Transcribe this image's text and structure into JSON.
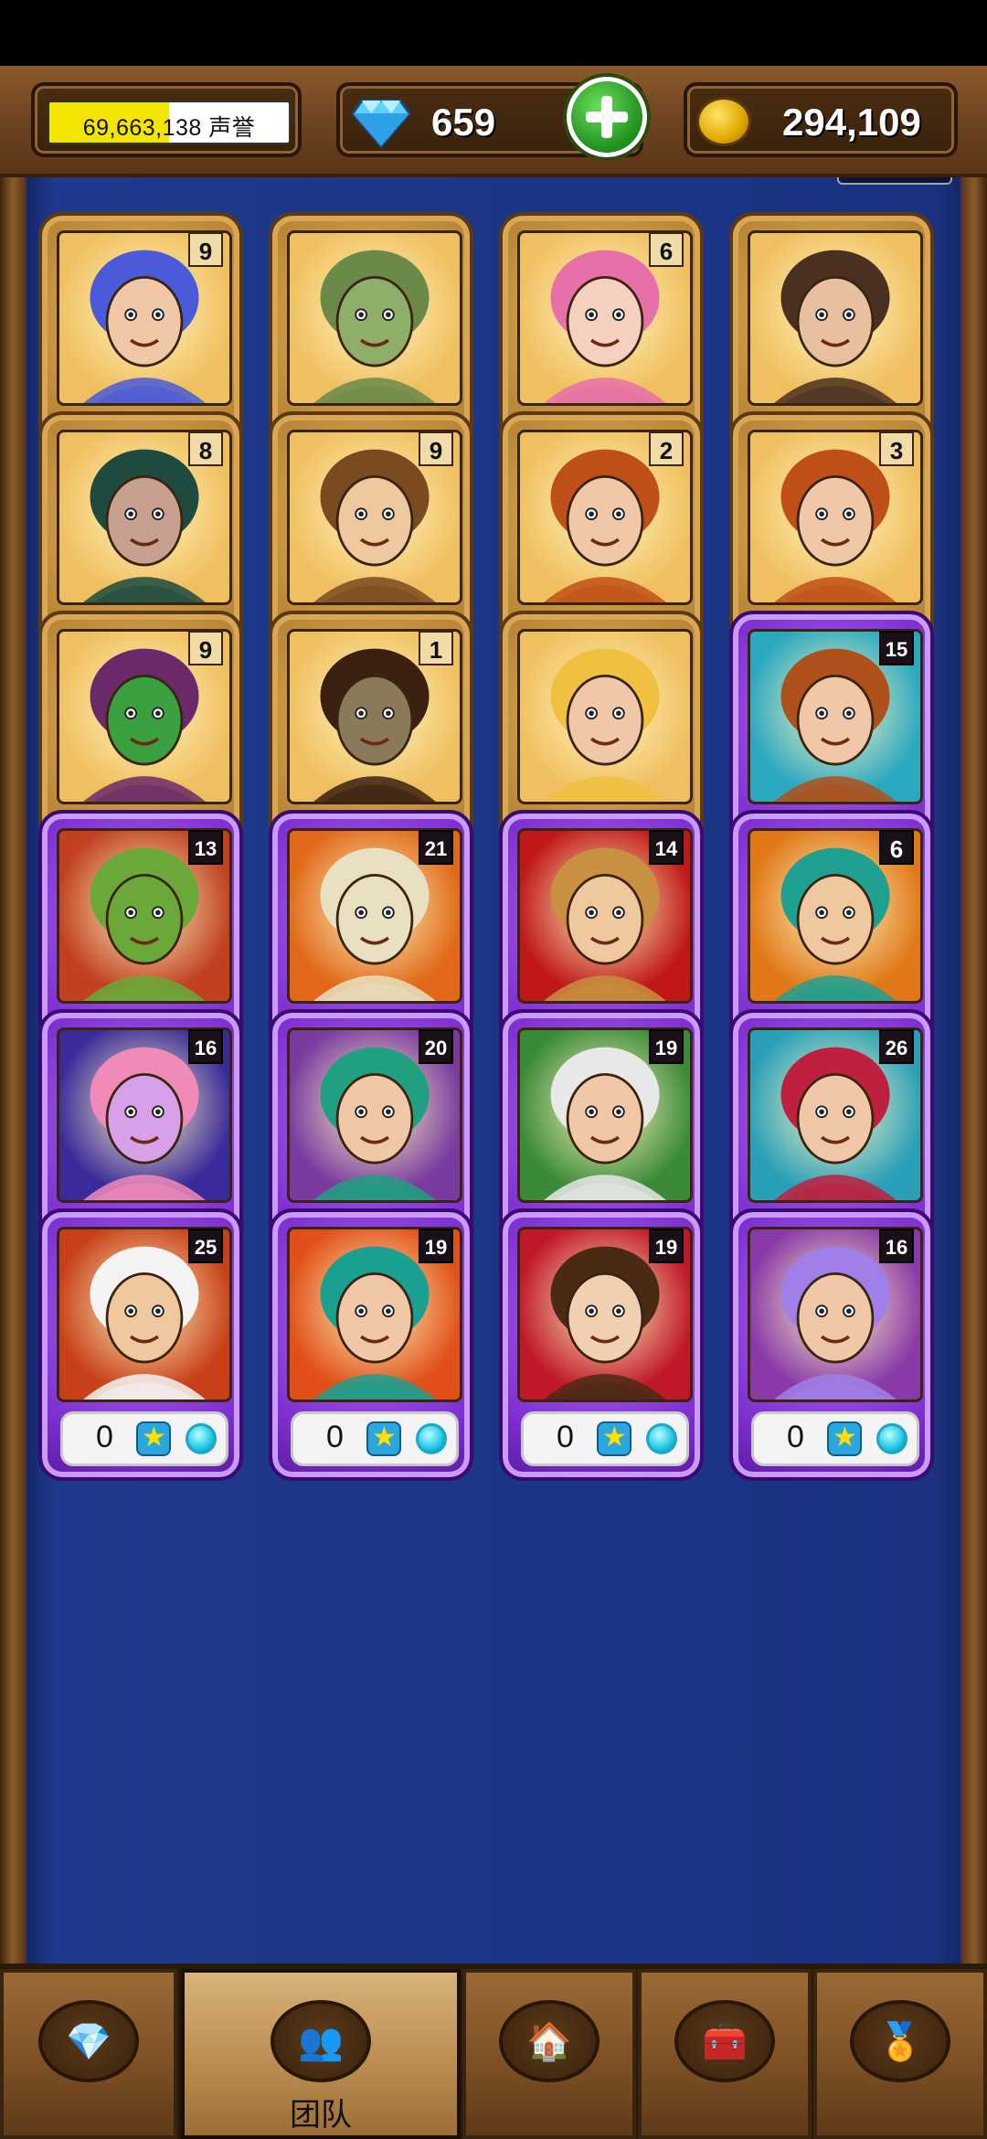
{
  "header": {
    "reputation": {
      "value": "69,663,138",
      "label": "声誉",
      "progress": 0.5
    },
    "gems": {
      "value": "659",
      "icon": "diamond-icon"
    },
    "add_button_icon": "plus-icon",
    "coins": {
      "value": "294,109",
      "icon": "coin-icon"
    }
  },
  "cards": [
    {
      "kind": "gold",
      "level": "9",
      "fill": 0.22,
      "dot": "cyan",
      "bg": "#f0c060",
      "skin": "#f0c8a8",
      "hair": "#4a5ad8"
    },
    {
      "kind": "gold",
      "level": "",
      "fill": 0,
      "dot": "cyan",
      "bg": "#f0c060",
      "skin": "#8fae6a",
      "hair": "#6b8a4a"
    },
    {
      "kind": "gold",
      "level": "6",
      "fill": 0.72,
      "dot": "dark",
      "bg": "#f0c060",
      "skin": "#f5d0c0",
      "hair": "#e870a8"
    },
    {
      "kind": "gold",
      "level": "",
      "fill": 0,
      "dot": "dark",
      "bg": "#f0c060",
      "skin": "#e8c0a0",
      "hair": "#4a3020"
    },
    {
      "kind": "gold",
      "level": "8",
      "fill": 0.04,
      "dot": "cyan",
      "bg": "#f0c060",
      "skin": "#c8a090",
      "hair": "#1e4a40"
    },
    {
      "kind": "gold",
      "level": "9",
      "fill": 0.45,
      "dot": "cyan",
      "bg": "#f0c060",
      "skin": "#f0c8a0",
      "hair": "#7a4a20"
    },
    {
      "kind": "gold",
      "level": "2",
      "fill": 0.06,
      "dot": "dark",
      "bg": "#f0c060",
      "skin": "#f0c8a8",
      "hair": "#c0501a"
    },
    {
      "kind": "gold",
      "level": "3",
      "fill": 0.27,
      "dot": "dark",
      "bg": "#f0c060",
      "skin": "#f0c8a8",
      "hair": "#c0501a"
    },
    {
      "kind": "gold",
      "level": "9",
      "fill": 0.4,
      "dot": "cyan",
      "bg": "#f0c060",
      "skin": "#3aa040",
      "hair": "#6a2a6a"
    },
    {
      "kind": "gold",
      "level": "1",
      "fill": 0,
      "dot": "dark",
      "bg": "#f0c060",
      "skin": "#8a7a5a",
      "hair": "#3a2010"
    },
    {
      "kind": "gold",
      "level": "",
      "fill": 0,
      "dot": "dark",
      "bg": "#f0c060",
      "skin": "#f0c8a8",
      "hair": "#f0c040"
    },
    {
      "kind": "purple",
      "level": "15",
      "stars": "0",
      "dot": "cyan",
      "bg": "#2aa8c0",
      "skin": "#f0c8a8",
      "hair": "#b0501a"
    },
    {
      "kind": "purple",
      "level": "13",
      "stars": "0",
      "dot": "cyan",
      "bg": "#c04020",
      "skin": "#6aa83a",
      "hair": "#6aa83a"
    },
    {
      "kind": "purple",
      "level": "21",
      "stars": "0",
      "dot": "cyan",
      "bg": "#e06818",
      "skin": "#e8e0c0",
      "hair": "#e8e0c0"
    },
    {
      "kind": "purple",
      "level": "14",
      "stars": "0",
      "dot": "cyan",
      "bg": "#c01818",
      "skin": "#f0c8a0",
      "hair": "#c89040"
    },
    {
      "kind": "purple",
      "level": "6",
      "stars": "0",
      "dot": "cyan",
      "bg": "#e07818",
      "skin": "#f0c8a0",
      "hair": "#20a090"
    },
    {
      "kind": "purple",
      "level": "16",
      "stars": "0",
      "dot": "cyan",
      "bg": "#3a2a9a",
      "skin": "#d8a0e8",
      "hair": "#f08ab8"
    },
    {
      "kind": "purple",
      "level": "20",
      "stars": "0",
      "dot": "cyan",
      "bg": "#7a3aa0",
      "skin": "#f0c8a8",
      "hair": "#20a080"
    },
    {
      "kind": "purple",
      "level": "19",
      "stars": "0",
      "dot": "cyan",
      "bg": "#3a8a3a",
      "skin": "#f0c8a8",
      "hair": "#e8e8e8"
    },
    {
      "kind": "purple",
      "level": "26",
      "stars": "0",
      "dot": "cyan",
      "bg": "#2aa0b8",
      "skin": "#f0c8a8",
      "hair": "#c02040"
    },
    {
      "kind": "purple",
      "level": "25",
      "stars": "0",
      "dot": "cyan",
      "bg": "#c84018",
      "skin": "#f0c8a0",
      "hair": "#f4f4f4"
    },
    {
      "kind": "purple",
      "level": "19",
      "stars": "0",
      "dot": "cyan",
      "bg": "#e05018",
      "skin": "#f0c8a8",
      "hair": "#1aa090"
    },
    {
      "kind": "purple",
      "level": "19",
      "stars": "0",
      "dot": "cyan",
      "bg": "#c01828",
      "skin": "#f0d0b0",
      "hair": "#4a2a14"
    },
    {
      "kind": "purple",
      "level": "16",
      "stars": "0",
      "dot": "cyan",
      "bg": "#8a3aa8",
      "skin": "#f0c8a8",
      "hair": "#a080e8"
    }
  ],
  "nav": [
    {
      "icon": "diamond-icon",
      "label": "",
      "glyph": "💎"
    },
    {
      "icon": "team-icon",
      "label": "团队",
      "glyph": "👥"
    },
    {
      "icon": "house-icon",
      "label": "",
      "glyph": "🏠"
    },
    {
      "icon": "chest-icon",
      "label": "",
      "glyph": "🧰"
    },
    {
      "icon": "medal-icon",
      "label": "",
      "glyph": "🏅"
    }
  ],
  "nav_active": 1,
  "colors": {
    "gold_card": "#b98536",
    "purple_card": "#7d2fd0",
    "board": "#1f3a8c",
    "cyan_dot": "#21c7e4"
  }
}
